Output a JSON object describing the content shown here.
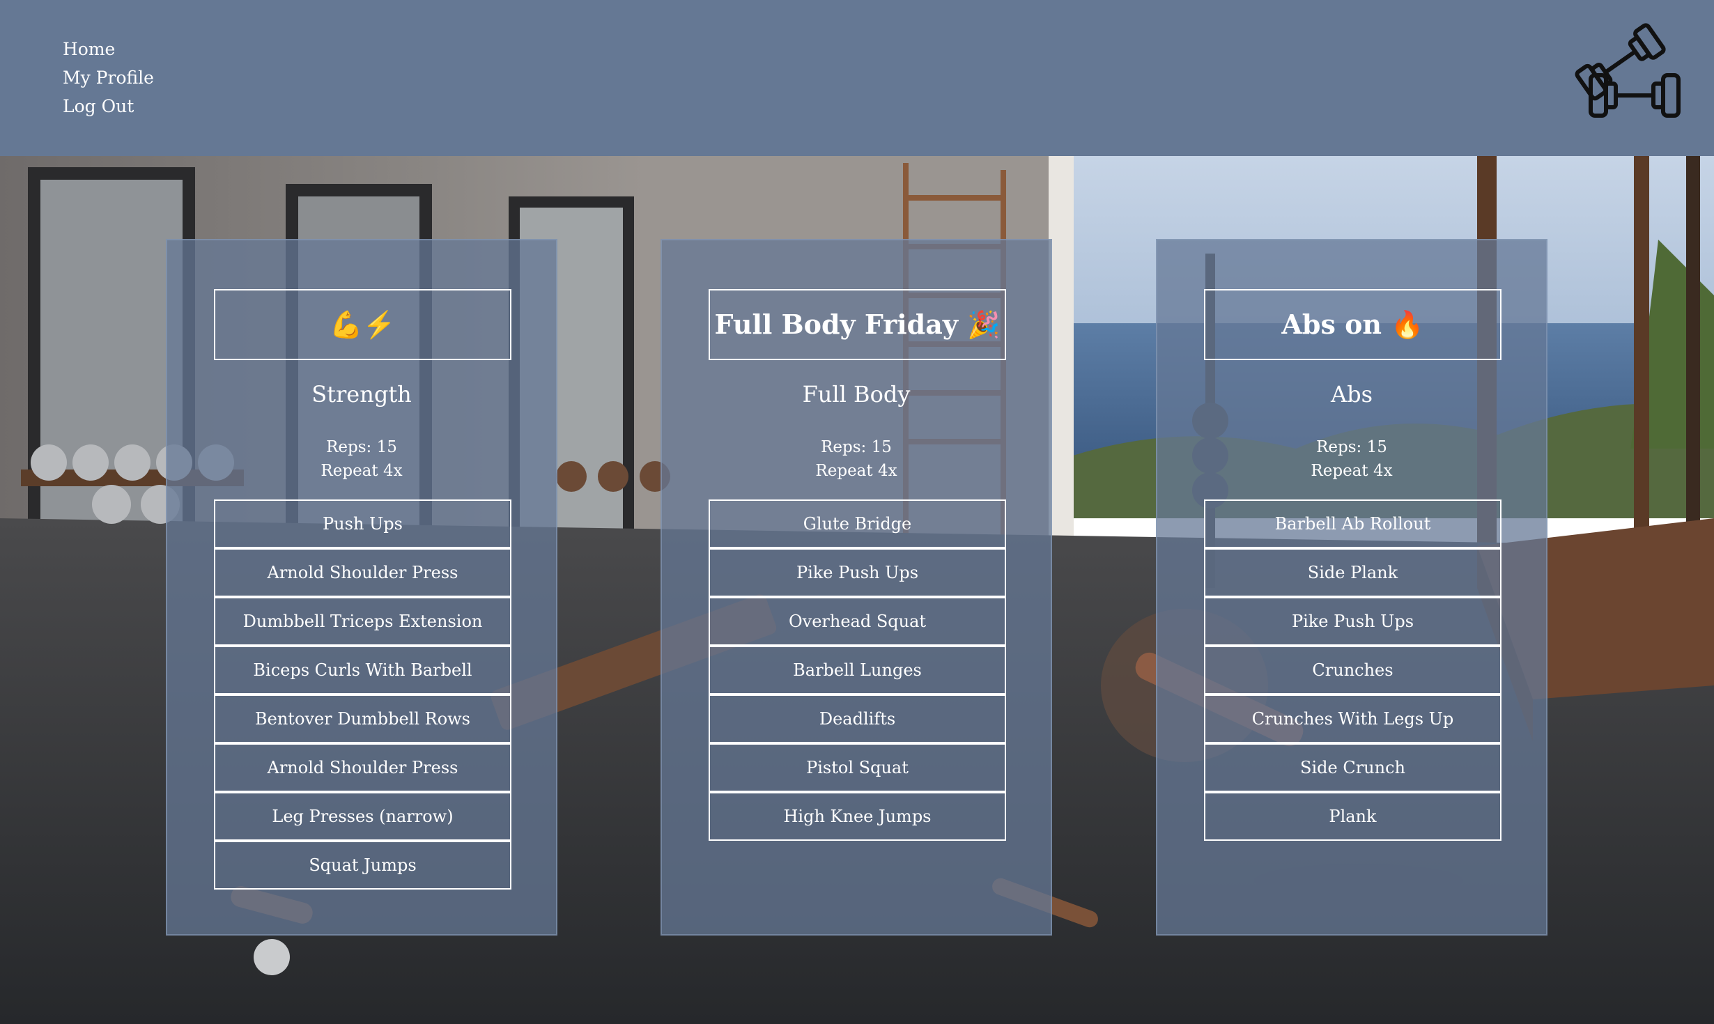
{
  "nav": {
    "items": [
      {
        "label": "Home"
      },
      {
        "label": "My Profile"
      },
      {
        "label": "Log Out"
      }
    ]
  },
  "logo": {
    "icon": "dumbbells-icon"
  },
  "workouts": [
    {
      "title": "💪⚡",
      "category": "Strength",
      "reps": "Reps: 15",
      "repeat": "Repeat 4x",
      "exercises": [
        "Push Ups",
        "Arnold Shoulder Press",
        "Dumbbell Triceps Extension",
        "Biceps Curls With Barbell",
        "Bentover Dumbbell Rows",
        "Arnold Shoulder Press",
        "Leg Presses (narrow)",
        "Squat Jumps"
      ]
    },
    {
      "title": "Full Body Friday 🎉",
      "category": "Full Body",
      "reps": "Reps: 15",
      "repeat": "Repeat 4x",
      "exercises": [
        "Glute Bridge",
        "Pike Push Ups",
        "Overhead Squat",
        "Barbell Lunges",
        "Deadlifts",
        "Pistol Squat",
        "High Knee Jumps"
      ]
    },
    {
      "title": "Abs on 🔥",
      "category": "Abs",
      "reps": "Reps: 15",
      "repeat": "Repeat 4x",
      "exercises": [
        "Barbell Ab Rollout",
        "Side Plank",
        "Pike Push Ups",
        "Crunches",
        "Crunches With Legs Up",
        "Side Crunch",
        "Plank"
      ]
    }
  ],
  "colors": {
    "header": "#657894",
    "card": "#657894",
    "text": "#ffffff"
  }
}
